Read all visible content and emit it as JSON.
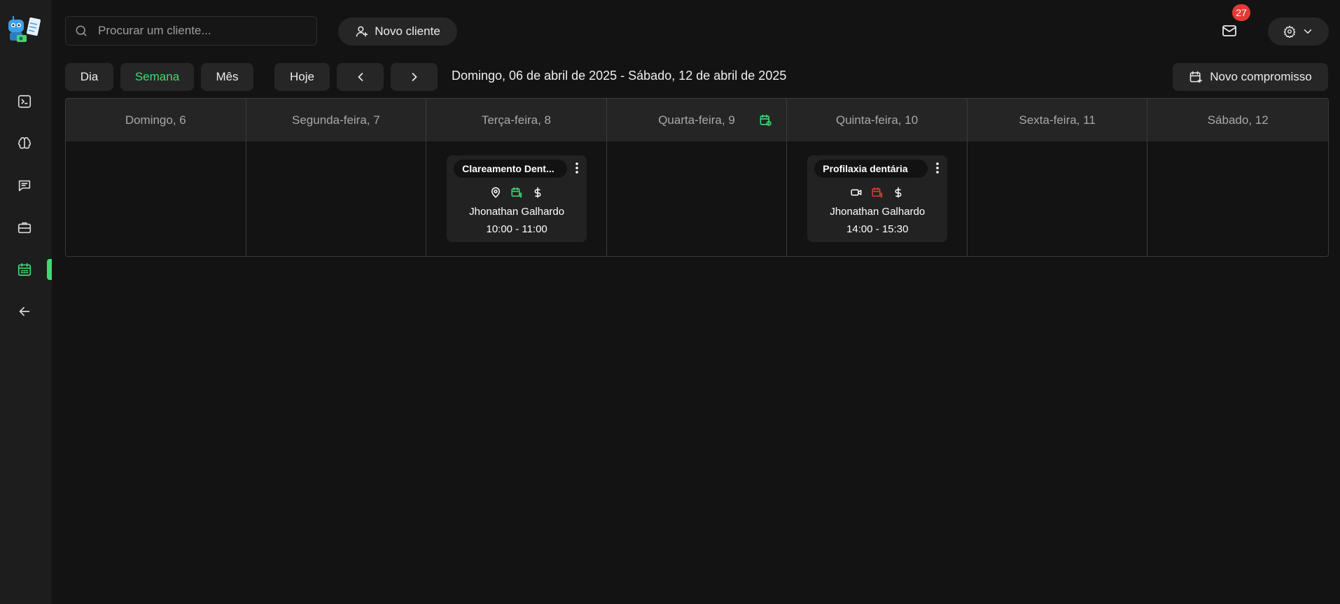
{
  "search": {
    "placeholder": "Procurar um cliente..."
  },
  "header": {
    "new_client_label": "Novo cliente",
    "mail_badge_count": "27"
  },
  "toolbar": {
    "views": {
      "day": "Dia",
      "week": "Semana",
      "month": "Mês"
    },
    "today_label": "Hoje",
    "date_range": "Domingo, 06 de abril de 2025 - Sábado, 12 de abril de 2025",
    "new_appointment_label": "Novo compromisso"
  },
  "calendar": {
    "days": [
      "Domingo, 6",
      "Segunda-feira, 7",
      "Terça-feira, 8",
      "Quarta-feira, 9",
      "Quinta-feira, 10",
      "Sexta-feira, 11",
      "Sábado, 12"
    ],
    "events": [
      {
        "title": "Clareamento Dent...",
        "person": "Jhonathan Galhardo",
        "time": "10:00 - 11:00",
        "icons": [
          "location-icon",
          "calendar-money-icon",
          "dollar-icon"
        ]
      },
      {
        "title": "Profilaxia dentária",
        "person": "Jhonathan Galhardo",
        "time": "14:00 - 15:30",
        "icons": [
          "video-icon",
          "calendar-money-icon",
          "dollar-icon"
        ]
      }
    ]
  },
  "colors": {
    "accent": "#3ddc73",
    "alert": "#e53935",
    "background": "#131313",
    "sidebar": "#1d1d1d",
    "surface": "#262626"
  }
}
